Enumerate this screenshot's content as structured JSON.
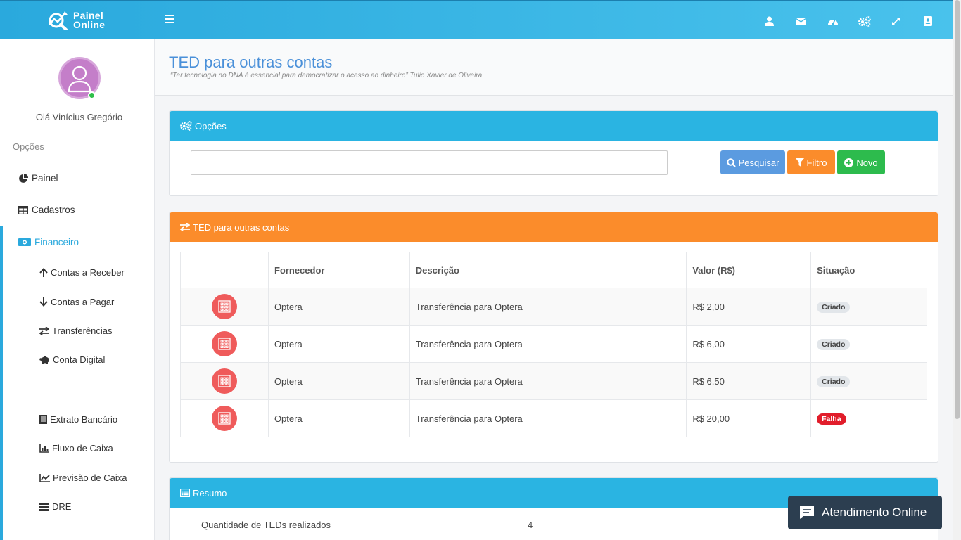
{
  "app": {
    "logo_line1": "Painel",
    "logo_line2": "Online"
  },
  "topbar": {
    "icons": [
      "user-icon",
      "envelope-icon",
      "dashboard-icon",
      "cogs-icon",
      "expand-icon",
      "address-book-icon"
    ]
  },
  "sidebar": {
    "greeting": "Olá Vinícius Gregório",
    "section_label": "Opções",
    "items": [
      {
        "label": "Painel",
        "icon": "pie-chart-icon"
      },
      {
        "label": "Cadastros",
        "icon": "table-icon"
      },
      {
        "label": "Financeiro",
        "icon": "money-icon"
      }
    ],
    "financeiro_sub": [
      {
        "label": "Contas a Receber",
        "icon": "arrow-up-icon"
      },
      {
        "label": "Contas a Pagar",
        "icon": "arrow-down-icon"
      },
      {
        "label": "Transferências",
        "icon": "exchange-icon"
      },
      {
        "label": "Conta Digital",
        "icon": "piggy-bank-icon"
      }
    ],
    "reports": [
      {
        "label": "Extrato Bancário",
        "icon": "receipt-icon"
      },
      {
        "label": "Fluxo de Caixa",
        "icon": "bar-chart-icon"
      },
      {
        "label": "Previsão de Caixa",
        "icon": "line-chart-icon"
      },
      {
        "label": "DRE",
        "icon": "list-icon"
      }
    ]
  },
  "page": {
    "title": "TED para outras contas",
    "subtitle": "“Ter tecnologia no DNA é essencial para democratizar o acesso ao dinheiro” Tulio Xavier de Oliveira"
  },
  "options_box": {
    "header": "Opções",
    "search_value": "",
    "btn_search": "Pesquisar",
    "btn_filter": "Filtro",
    "btn_new": "Novo"
  },
  "ted_box": {
    "header": "TED para outras contas",
    "columns": [
      "",
      "Fornecedor",
      "Descrição",
      "Valor (R$)",
      "Situação"
    ],
    "rows": [
      {
        "fornecedor": "Optera",
        "descricao": "Transferência para Optera",
        "valor": "R$ 2,00",
        "situacao": "Criado",
        "status_color": "#e2e6ea"
      },
      {
        "fornecedor": "Optera",
        "descricao": "Transferência para Optera",
        "valor": "R$ 6,00",
        "situacao": "Criado",
        "status_color": "#e2e6ea"
      },
      {
        "fornecedor": "Optera",
        "descricao": "Transferência para Optera",
        "valor": "R$ 6,50",
        "situacao": "Criado",
        "status_color": "#e2e6ea"
      },
      {
        "fornecedor": "Optera",
        "descricao": "Transferência para Optera",
        "valor": "R$ 20,00",
        "situacao": "Falha",
        "status_color": "#e11d2b"
      }
    ]
  },
  "resumo_box": {
    "header": "Resumo",
    "qty_label": "Quantidade de TEDs realizados",
    "qty_value": "4"
  },
  "chat": {
    "label": "Atendimento Online"
  },
  "colors": {
    "topbar": "#2aa9dd",
    "accent": "#2aa9dd",
    "orange": "#fb8c2b",
    "green": "#2dbb4d",
    "danger": "#e11d2b"
  }
}
